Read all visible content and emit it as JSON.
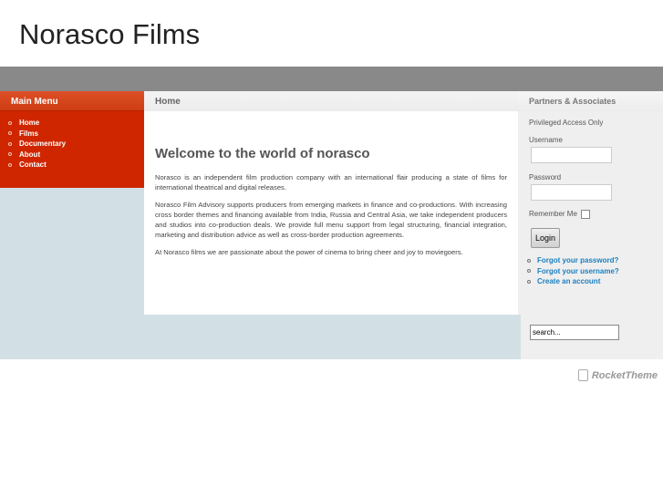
{
  "site_title": "Norasco Films",
  "main_menu": {
    "title": "Main Menu",
    "items": [
      "Home",
      "Films",
      "Documentary",
      "About",
      "Contact"
    ]
  },
  "breadcrumb": "Home",
  "content": {
    "heading": "Welcome to the world of norasco",
    "paragraphs": [
      "Norasco is an independent film production company with an international flair producing a state of films for international theatrical and digital releases.",
      "Norasco Film Advisory supports producers from emerging markets in finance and co-productions. With increasing cross border themes and financing available from India, Russia and Central Asia, we take independent producers and studios into co-production deals. We provide full menu support from legal structuring, financial integration, marketing and distribution advice as well as cross-border production agreements.",
      "At Norasco films we are passionate about the power of cinema to bring cheer and joy to moviegoers."
    ]
  },
  "login": {
    "title": "Partners & Associates",
    "subtitle": "Privileged Access Only",
    "username_label": "Username",
    "username_value": "",
    "password_label": "Password",
    "password_value": "",
    "remember_label": "Remember Me",
    "button": "Login",
    "links": [
      "Forgot your password?",
      "Forgot your username?",
      "Create an account"
    ]
  },
  "search": {
    "value": "search..."
  },
  "footer": {
    "logo_text": "RocketTheme"
  }
}
